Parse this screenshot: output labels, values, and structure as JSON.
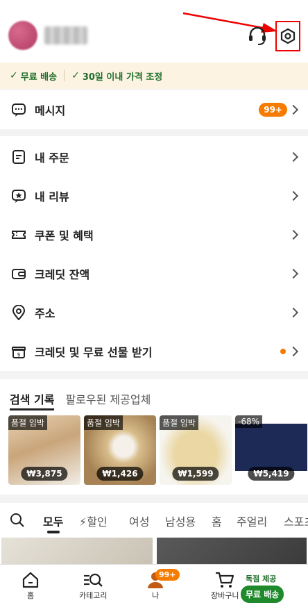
{
  "header": {
    "username_blurred": "",
    "support_label": "",
    "settings_label": ""
  },
  "benefits": {
    "free_shipping": "무료 배송",
    "price_adjust": "30일 이내 가격 조정"
  },
  "message": {
    "label": "메시지",
    "badge": "99+"
  },
  "menu": [
    {
      "label": "내 주문"
    },
    {
      "label": "내 리뷰"
    },
    {
      "label": "쿠폰 및 혜택"
    },
    {
      "label": "크레딧 잔액"
    },
    {
      "label": "주소"
    },
    {
      "label": "크레딧 및 무료 선물 받기"
    }
  ],
  "history": {
    "tab_active": "검색 기록",
    "tab_other": "팔로우된 제공업체",
    "items": [
      {
        "tag": "품절 임박",
        "price": "₩3,875"
      },
      {
        "tag": "품절 임박",
        "price": "₩1,426"
      },
      {
        "tag": "품절 임박",
        "price": "₩1,599"
      },
      {
        "tag": "-68%",
        "price": "₩5,419"
      }
    ]
  },
  "categories": {
    "active": "모두",
    "sale": "할인",
    "women": "여성",
    "men": "남성용",
    "home": "홈",
    "jewelry": "주얼리",
    "sports": "스포츠"
  },
  "bottom_nav": {
    "home": "홈",
    "category": "카테고리",
    "me": "나",
    "me_badge": "99+",
    "cart": "장바구니",
    "promo_top": "독점 제공",
    "promo_btn": "무료 배송"
  },
  "colors": {
    "accent": "#f57c00",
    "green": "#1f6f2a",
    "highlight": "#ee0000"
  }
}
